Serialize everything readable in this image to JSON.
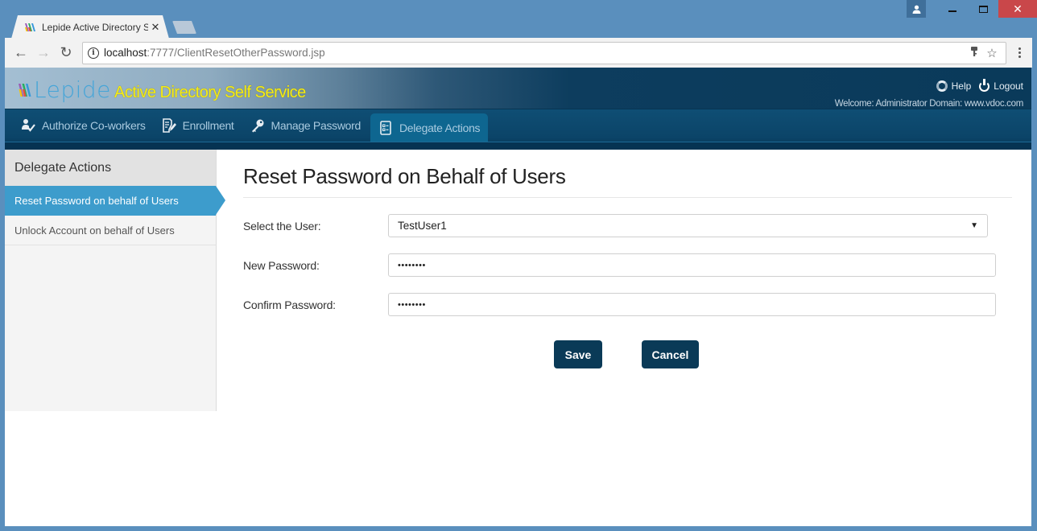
{
  "browser": {
    "tab": {
      "title": "Lepide Active Directory S",
      "close_glyph": "✕"
    },
    "url": {
      "host": "localhost",
      "path": ":7777/ClientResetOtherPassword.jsp"
    },
    "icons": {
      "back": "←",
      "forward": "→",
      "reload": "↻",
      "key": "🔑",
      "star": "☆"
    },
    "window_controls": {
      "close": "✕",
      "profile": "👤"
    }
  },
  "app": {
    "logo_text": "Lepide",
    "title": "Active Directory Self Service",
    "help_label": "Help",
    "logout_label": "Logout",
    "welcome_text": "Welcome: Administrator  Domain: www.vdoc.com",
    "accent_color": "#3d9ccc",
    "nav": [
      {
        "label": "Authorize Co-workers",
        "icon": "user-check-icon",
        "active": false
      },
      {
        "label": "Enrollment",
        "icon": "document-edit-icon",
        "active": false
      },
      {
        "label": "Manage Password",
        "icon": "key-icon",
        "active": false
      },
      {
        "label": "Delegate Actions",
        "icon": "checklist-icon",
        "active": true
      }
    ]
  },
  "sidebar": {
    "header": "Delegate Actions",
    "items": [
      {
        "label": "Reset Password on behalf of Users",
        "active": true
      },
      {
        "label": "Unlock Account on behalf of Users",
        "active": false
      }
    ]
  },
  "form": {
    "title": "Reset Password on Behalf of Users",
    "select_user_label": "Select the User:",
    "select_user_value": "TestUser1",
    "new_password_label": "New Password:",
    "new_password_value": "••••••••",
    "confirm_password_label": "Confirm Password:",
    "confirm_password_value": "••••••••",
    "save_label": "Save",
    "cancel_label": "Cancel"
  }
}
